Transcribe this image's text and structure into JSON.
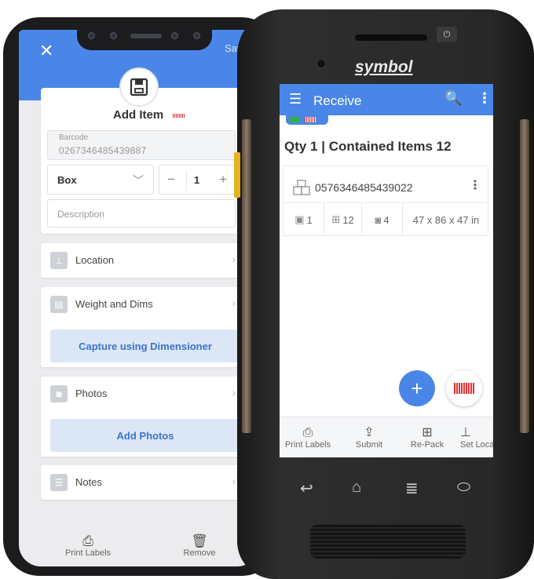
{
  "left_phone": {
    "save_label": "Save",
    "title": "Add Item",
    "barcode": {
      "label": "Barcode",
      "value": "0267346485439887"
    },
    "package_type": "Box",
    "quantity": "1",
    "description_placeholder": "Description",
    "sections": [
      {
        "label": "Location",
        "icon": "location-icon"
      },
      {
        "label": "Weight and Dims",
        "icon": "scale-icon",
        "action": "Capture using Dimensioner"
      },
      {
        "label": "Photos",
        "icon": "camera-icon",
        "action": "Add Photos"
      },
      {
        "label": "Notes",
        "icon": "notes-icon"
      }
    ],
    "bottom_bar": [
      {
        "label": "Print Labels",
        "icon": "printer-icon"
      },
      {
        "label": "Remove",
        "icon": "trash-icon"
      }
    ]
  },
  "device": {
    "brand": "symbol",
    "app_bar": {
      "title": "Receive"
    },
    "summary": "Qty 1 | Contained Items 12",
    "item": {
      "barcode": "0576346485439022",
      "stats": [
        {
          "icon": "box-icon",
          "value": "1"
        },
        {
          "icon": "packages-icon",
          "value": "12"
        },
        {
          "icon": "camera-icon",
          "value": "4"
        },
        {
          "icon": "",
          "value": "47 x 86 x 47 in"
        }
      ]
    },
    "bottom_nav": [
      {
        "label": "Print Labels",
        "icon": "printer-icon"
      },
      {
        "label": "Submit",
        "icon": "upload-icon"
      },
      {
        "label": "Re-Pack",
        "icon": "repack-icon"
      },
      {
        "label": "Set Loca",
        "icon": "location-icon"
      }
    ]
  },
  "colors": {
    "primary": "#4a86e8",
    "accent_green": "#32b04a",
    "barcode_red": "#d33333"
  }
}
